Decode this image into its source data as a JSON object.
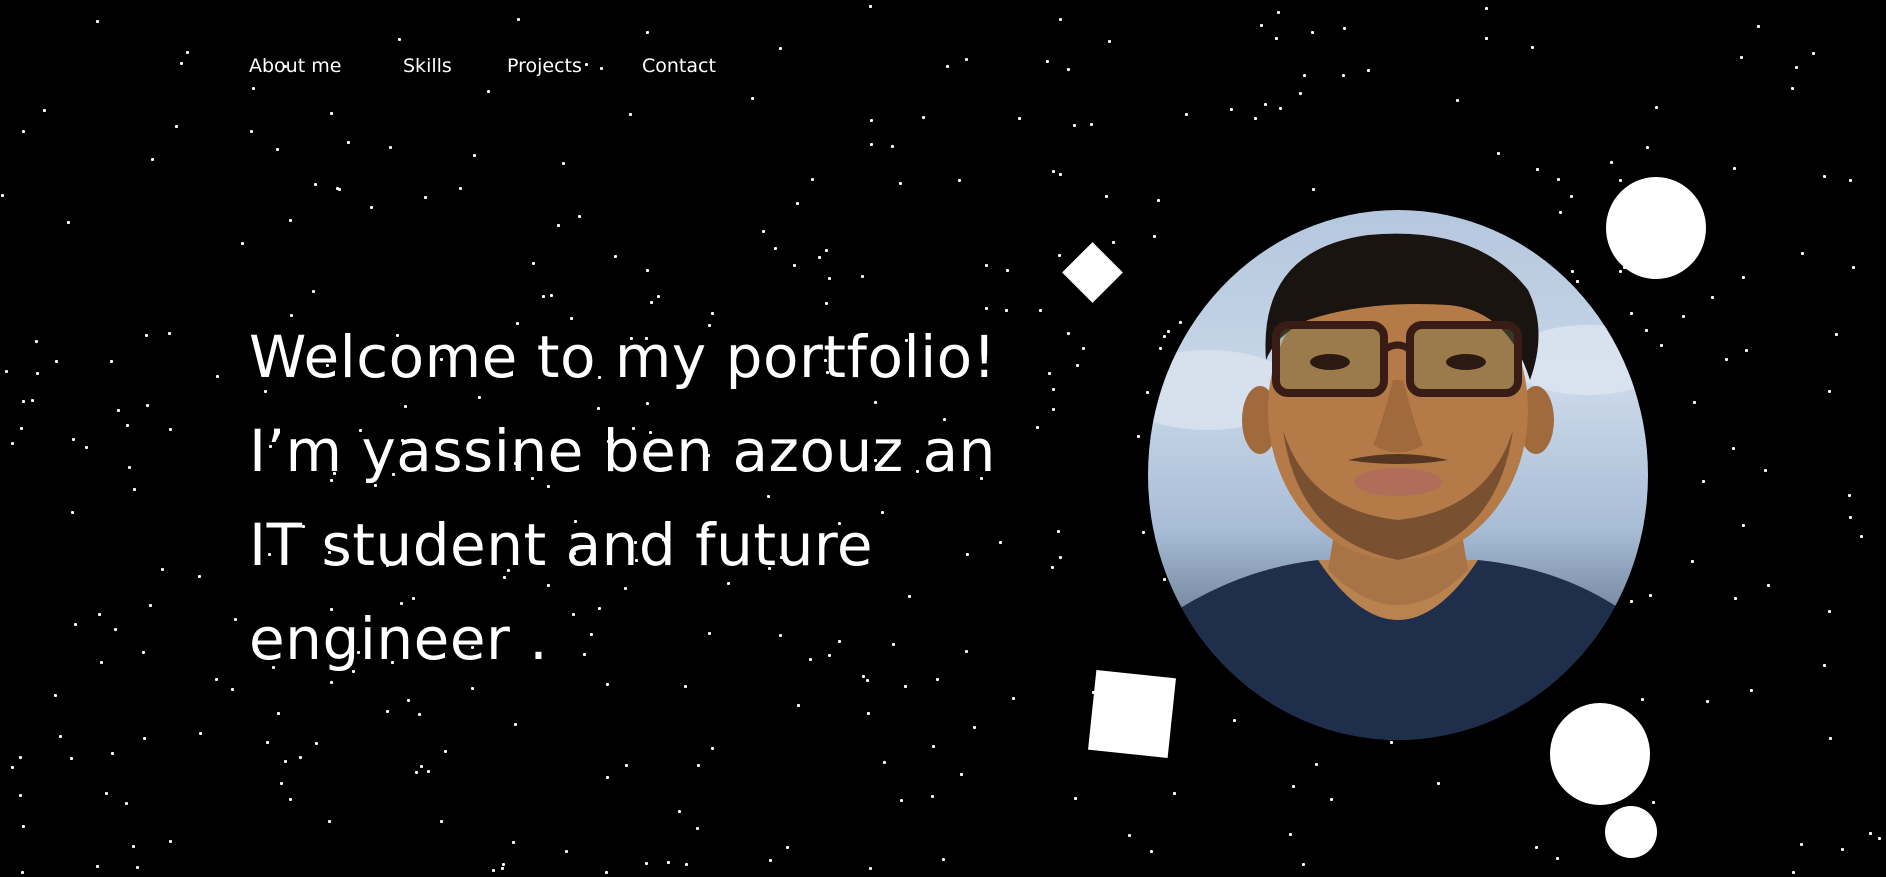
{
  "nav": {
    "items": [
      {
        "label": "About me"
      },
      {
        "label": "Skills"
      },
      {
        "label": "Projects"
      },
      {
        "label": "Contact"
      }
    ]
  },
  "hero": {
    "lines": [
      "Welcome to my portfolio!",
      "I’m yassine ben azouz an",
      "IT student and future",
      "engineer ."
    ]
  },
  "profile": {
    "image": "profile-photo"
  },
  "colors": {
    "background": "#000000",
    "foreground": "#ffffff"
  }
}
